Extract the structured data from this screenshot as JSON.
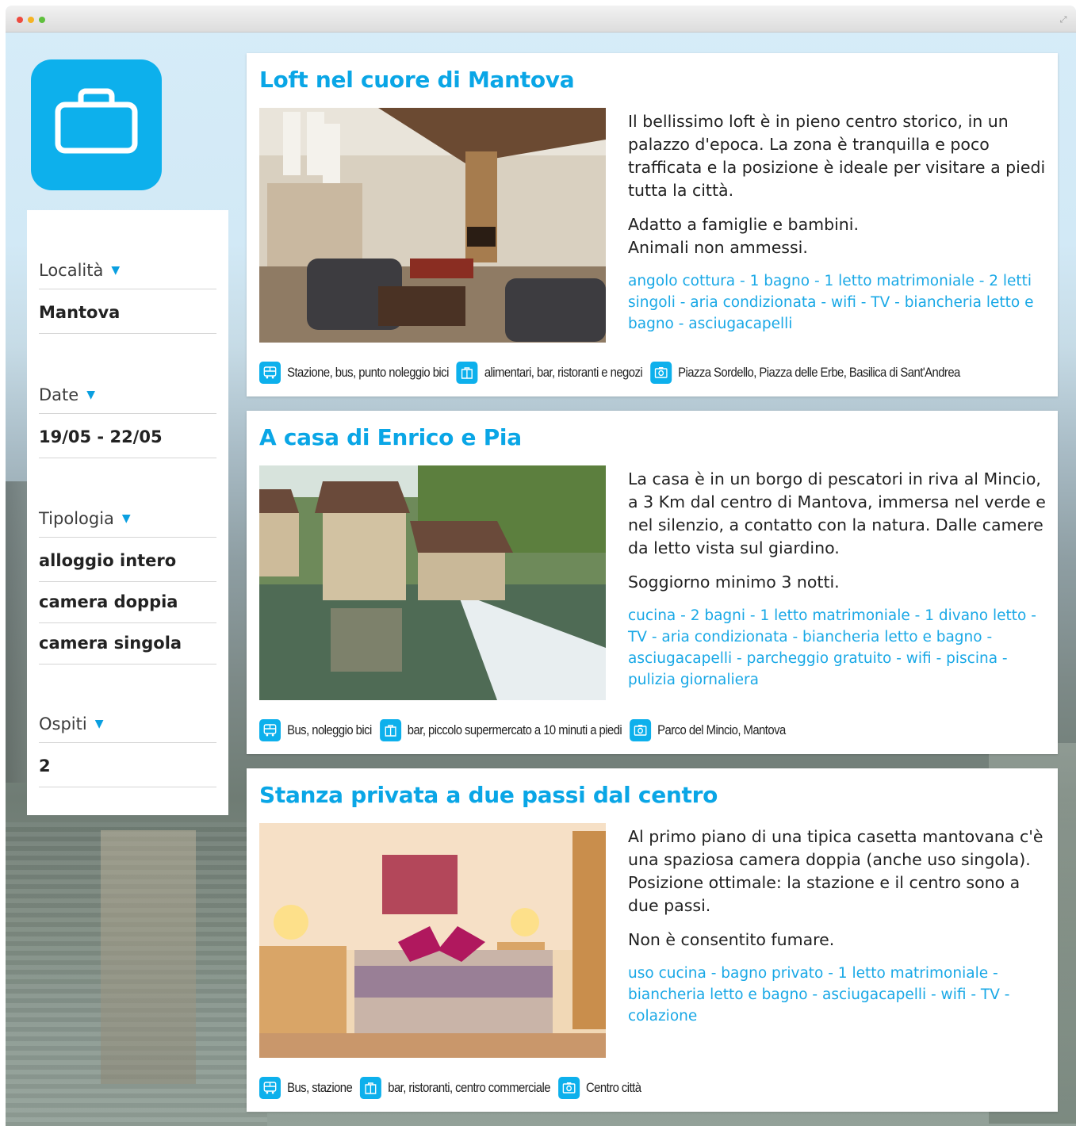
{
  "sidebar": {
    "app_icon": "suitcase-icon",
    "filters": {
      "location": {
        "label": "Località",
        "value": "Mantova"
      },
      "dates": {
        "label": "Date",
        "value": "19/05 - 22/05"
      },
      "type": {
        "label": "Tipologia",
        "options": [
          "alloggio intero",
          "camera doppia",
          "camera singola"
        ]
      },
      "guests": {
        "label": "Ospiti",
        "value": "2"
      }
    },
    "caret": "▼"
  },
  "listings": [
    {
      "title": "Loft nel cuore di Mantova",
      "description": [
        "Il bellissimo loft è in pieno centro storico, in un palazzo d'epoca. La zona è tranquilla e poco trafficata e la posizione è ideale per visitare a piedi tutta la città.",
        "Adatto a famiglie e bambini.\nAnimali non ammessi."
      ],
      "amenities": "angolo cottura - 1 bagno -  1 letto matrimoniale - 2 letti singoli - aria condizionata - wifi - TV - biancheria letto e bagno - asciugacapelli",
      "transport": "Stazione, bus, punto noleggio bici",
      "shops": "alimentari, bar, ristoranti e negozi",
      "sights": "Piazza Sordello, Piazza delle Erbe, Basilica di Sant'Andrea"
    },
    {
      "title": "A casa di Enrico e Pia",
      "description": [
        "La casa è in un borgo di pescatori in riva al Mincio, a 3 Km dal centro di Mantova, immersa nel verde e nel silenzio, a contatto con la natura. Dalle camere da letto vista sul giardino.",
        "Soggiorno minimo 3 notti."
      ],
      "amenities": "cucina - 2 bagni - 1 letto matrimoniale - 1 divano letto - TV - aria condizionata -  biancheria letto e bagno - asciugacapelli - parcheggio gratuito - wifi - piscina - pulizia giornaliera",
      "transport": "Bus, noleggio bici",
      "shops": "bar, piccolo supermercato a 10 minuti a piedi",
      "sights": "Parco del Mincio, Mantova"
    },
    {
      "title": "Stanza privata a due passi dal centro",
      "description": [
        "Al primo piano di una tipica casetta mantovana c'è una spaziosa camera doppia (anche uso singola). Posizione ottimale: la stazione e il centro sono a due passi.",
        "Non è consentito fumare."
      ],
      "amenities": "uso cucina - bagno privato - 1 letto matrimoniale - biancheria letto e bagno - asciugacapelli - wifi - TV - colazione",
      "transport": "Bus, stazione",
      "shops": "bar, ristoranti, centro commerciale",
      "sights": "Centro città"
    }
  ],
  "icons": {
    "transport": "bus-icon",
    "shops": "shop-icon",
    "sights": "camera-icon"
  },
  "colors": {
    "accent": "#0db0ec",
    "title": "#0aa6e6",
    "amenities": "#19a8e6"
  }
}
